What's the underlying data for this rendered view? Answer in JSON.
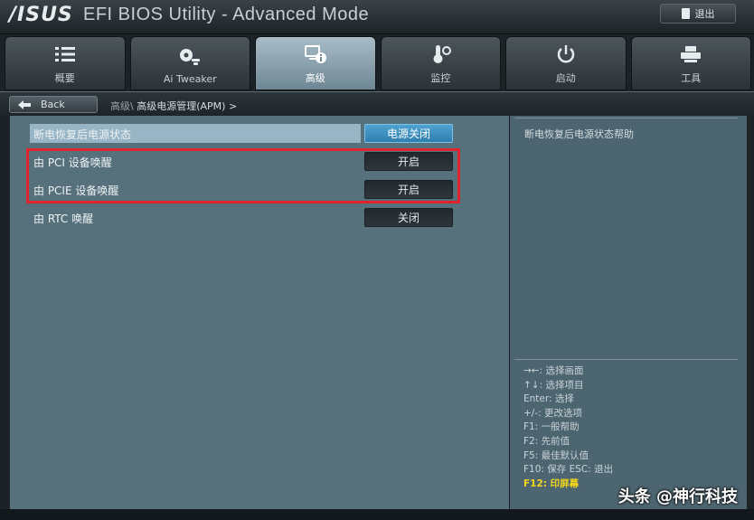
{
  "header": {
    "logo": "/ISUS",
    "title": "EFI BIOS Utility - Advanced Mode",
    "exit_label": "退出"
  },
  "tabs": [
    {
      "label": "概要",
      "icon": "list-icon"
    },
    {
      "label": "Ai Tweaker",
      "icon": "fan-tweak-icon"
    },
    {
      "label": "高级",
      "icon": "advanced-info-icon",
      "active": true
    },
    {
      "label": "监控",
      "icon": "thermometer-fan-icon"
    },
    {
      "label": "启动",
      "icon": "power-icon"
    },
    {
      "label": "工具",
      "icon": "printer-tool-icon"
    }
  ],
  "nav": {
    "back_label": "Back",
    "breadcrumb_parent": "高级\\",
    "breadcrumb_current": "高级电源管理(APM)",
    "breadcrumb_arrow": ">"
  },
  "settings": [
    {
      "label": "断电恢复后电源状态",
      "value": "电源关闭",
      "selected": true
    },
    {
      "label": "由 PCI 设备唤醒",
      "value": "开启"
    },
    {
      "label": "由 PCIE 设备唤醒",
      "value": "开启"
    },
    {
      "label": "由 RTC 唤醒",
      "value": "关闭"
    }
  ],
  "help": {
    "text": "断电恢复后电源状态帮助",
    "keys": [
      "→←: 选择画面",
      "↑↓: 选择项目",
      "Enter: 选择",
      "+/-: 更改选项",
      "F1: 一般帮助",
      "F2: 先前值",
      "F5: 最佳默认值",
      "F10: 保存  ESC: 退出"
    ],
    "key_highlight": "F12: 印屏幕"
  },
  "watermark": "头条 @神行科技",
  "colors": {
    "accent": "#4fa3d0",
    "highlight_box": "#e0242c",
    "key_highlight": "#f2d41c"
  }
}
